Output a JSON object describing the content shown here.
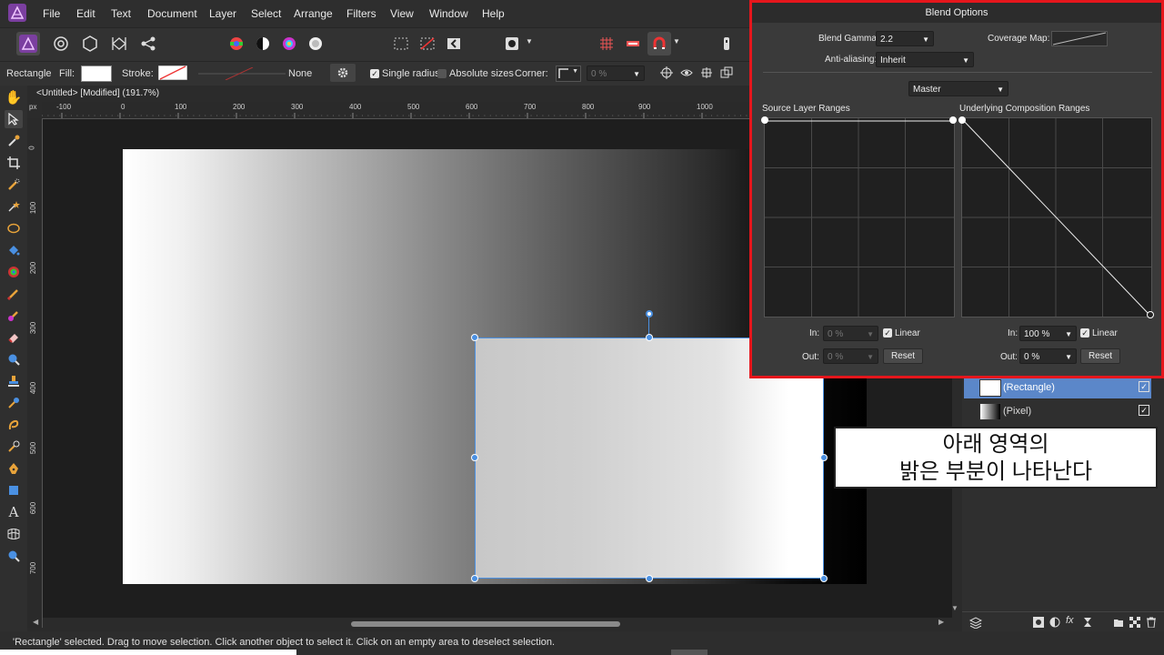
{
  "menu": [
    "File",
    "Edit",
    "Text",
    "Document",
    "Layer",
    "Select",
    "Arrange",
    "Filters",
    "View",
    "Window",
    "Help"
  ],
  "context": {
    "shape": "Rectangle",
    "fill_label": "Fill:",
    "stroke_label": "Stroke:",
    "stroke_none": "None",
    "single_radius": "Single radius",
    "absolute_sizes": "Absolute sizes",
    "corner_label": "Corner:",
    "corner_value": "0 %"
  },
  "document": {
    "tab": "<Untitled> [Modified] (191.7%)",
    "ruler_unit": "px",
    "h_ticks": [
      "-100",
      "0",
      "100",
      "200",
      "300",
      "400",
      "500",
      "600",
      "700",
      "800",
      "900",
      "1000"
    ],
    "v_ticks": [
      "0",
      "100",
      "200",
      "300",
      "400",
      "500",
      "600",
      "700"
    ]
  },
  "blend": {
    "title": "Blend Options",
    "gamma_label": "Blend Gamma:",
    "gamma_value": "2.2",
    "coverage_label": "Coverage Map:",
    "aa_label": "Anti-aliasing:",
    "aa_value": "Inherit",
    "channel": "Master",
    "source_title": "Source Layer Ranges",
    "underlying_title": "Underlying Composition Ranges",
    "in_label": "In:",
    "out_label": "Out:",
    "src_in": "0 %",
    "src_out": "0 %",
    "und_in": "100 %",
    "und_out": "0 %",
    "linear": "Linear",
    "reset": "Reset"
  },
  "layers": [
    {
      "name": "(Rectangle)",
      "selected": true
    },
    {
      "name": "(Pixel)",
      "selected": false
    }
  ],
  "callout": {
    "line1": "아래 영역의",
    "line2": "밝은 부분이 나타난다"
  },
  "status": {
    "text": "'Rectangle' selected. Drag to move selection. Click another object to select it. Click on an empty area to deselect selection."
  },
  "colors": {
    "accent": "#4a90e2",
    "highlight_border": "#e5161c",
    "layer_selected": "#5b87c9"
  }
}
